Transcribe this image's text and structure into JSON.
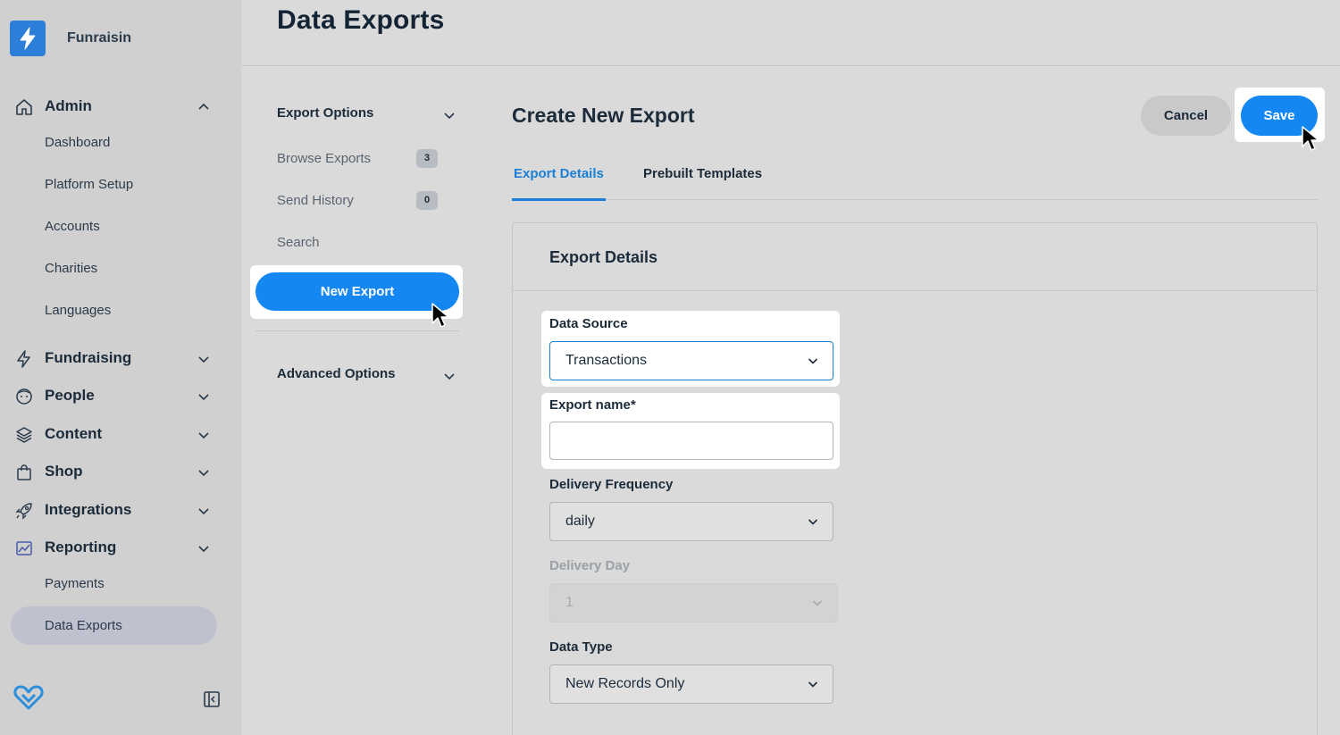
{
  "brand": {
    "name": "Funraisin",
    "logo_icon": "lightning-bolt-icon",
    "accent": "#2b7fd9"
  },
  "sidebar": {
    "admin": {
      "label": "Admin",
      "icon": "home-icon"
    },
    "admin_items": [
      "Dashboard",
      "Platform Setup",
      "Accounts",
      "Charities",
      "Languages"
    ],
    "groups": [
      {
        "label": "Fundraising",
        "icon": "lightning-icon"
      },
      {
        "label": "People",
        "icon": "face-icon"
      },
      {
        "label": "Content",
        "icon": "layers-icon"
      },
      {
        "label": "Shop",
        "icon": "shopping-bag-icon"
      },
      {
        "label": "Integrations",
        "icon": "rocket-icon"
      },
      {
        "label": "Reporting",
        "icon": "chart-icon"
      }
    ],
    "reporting_items": [
      "Payments",
      "Data Exports"
    ],
    "active_item": "Data Exports"
  },
  "header": {
    "title": "Data Exports"
  },
  "options": {
    "export_options_label": "Export Options",
    "items": [
      {
        "label": "Browse Exports",
        "count": "3"
      },
      {
        "label": "Send History",
        "count": "0"
      },
      {
        "label": "Search"
      }
    ],
    "new_export_label": "New Export",
    "advanced_options_label": "Advanced Options"
  },
  "main": {
    "title": "Create New Export",
    "cancel_label": "Cancel",
    "save_label": "Save",
    "tabs": [
      {
        "label": "Export Details",
        "active": true
      },
      {
        "label": "Prebuilt Templates",
        "active": false
      }
    ],
    "panel_title": "Export Details",
    "form": {
      "data_source": {
        "label": "Data Source",
        "value": "Transactions"
      },
      "export_name": {
        "label": "Export name*",
        "value": ""
      },
      "delivery_frequency": {
        "label": "Delivery Frequency",
        "value": "daily"
      },
      "delivery_day": {
        "label": "Delivery Day",
        "value": "1"
      },
      "data_type": {
        "label": "Data Type",
        "value": "New Records Only"
      }
    }
  },
  "colors": {
    "primary": "#1487f2",
    "active_tab": "#1a7fd6",
    "sidebar_active": "#bfc2ce"
  }
}
